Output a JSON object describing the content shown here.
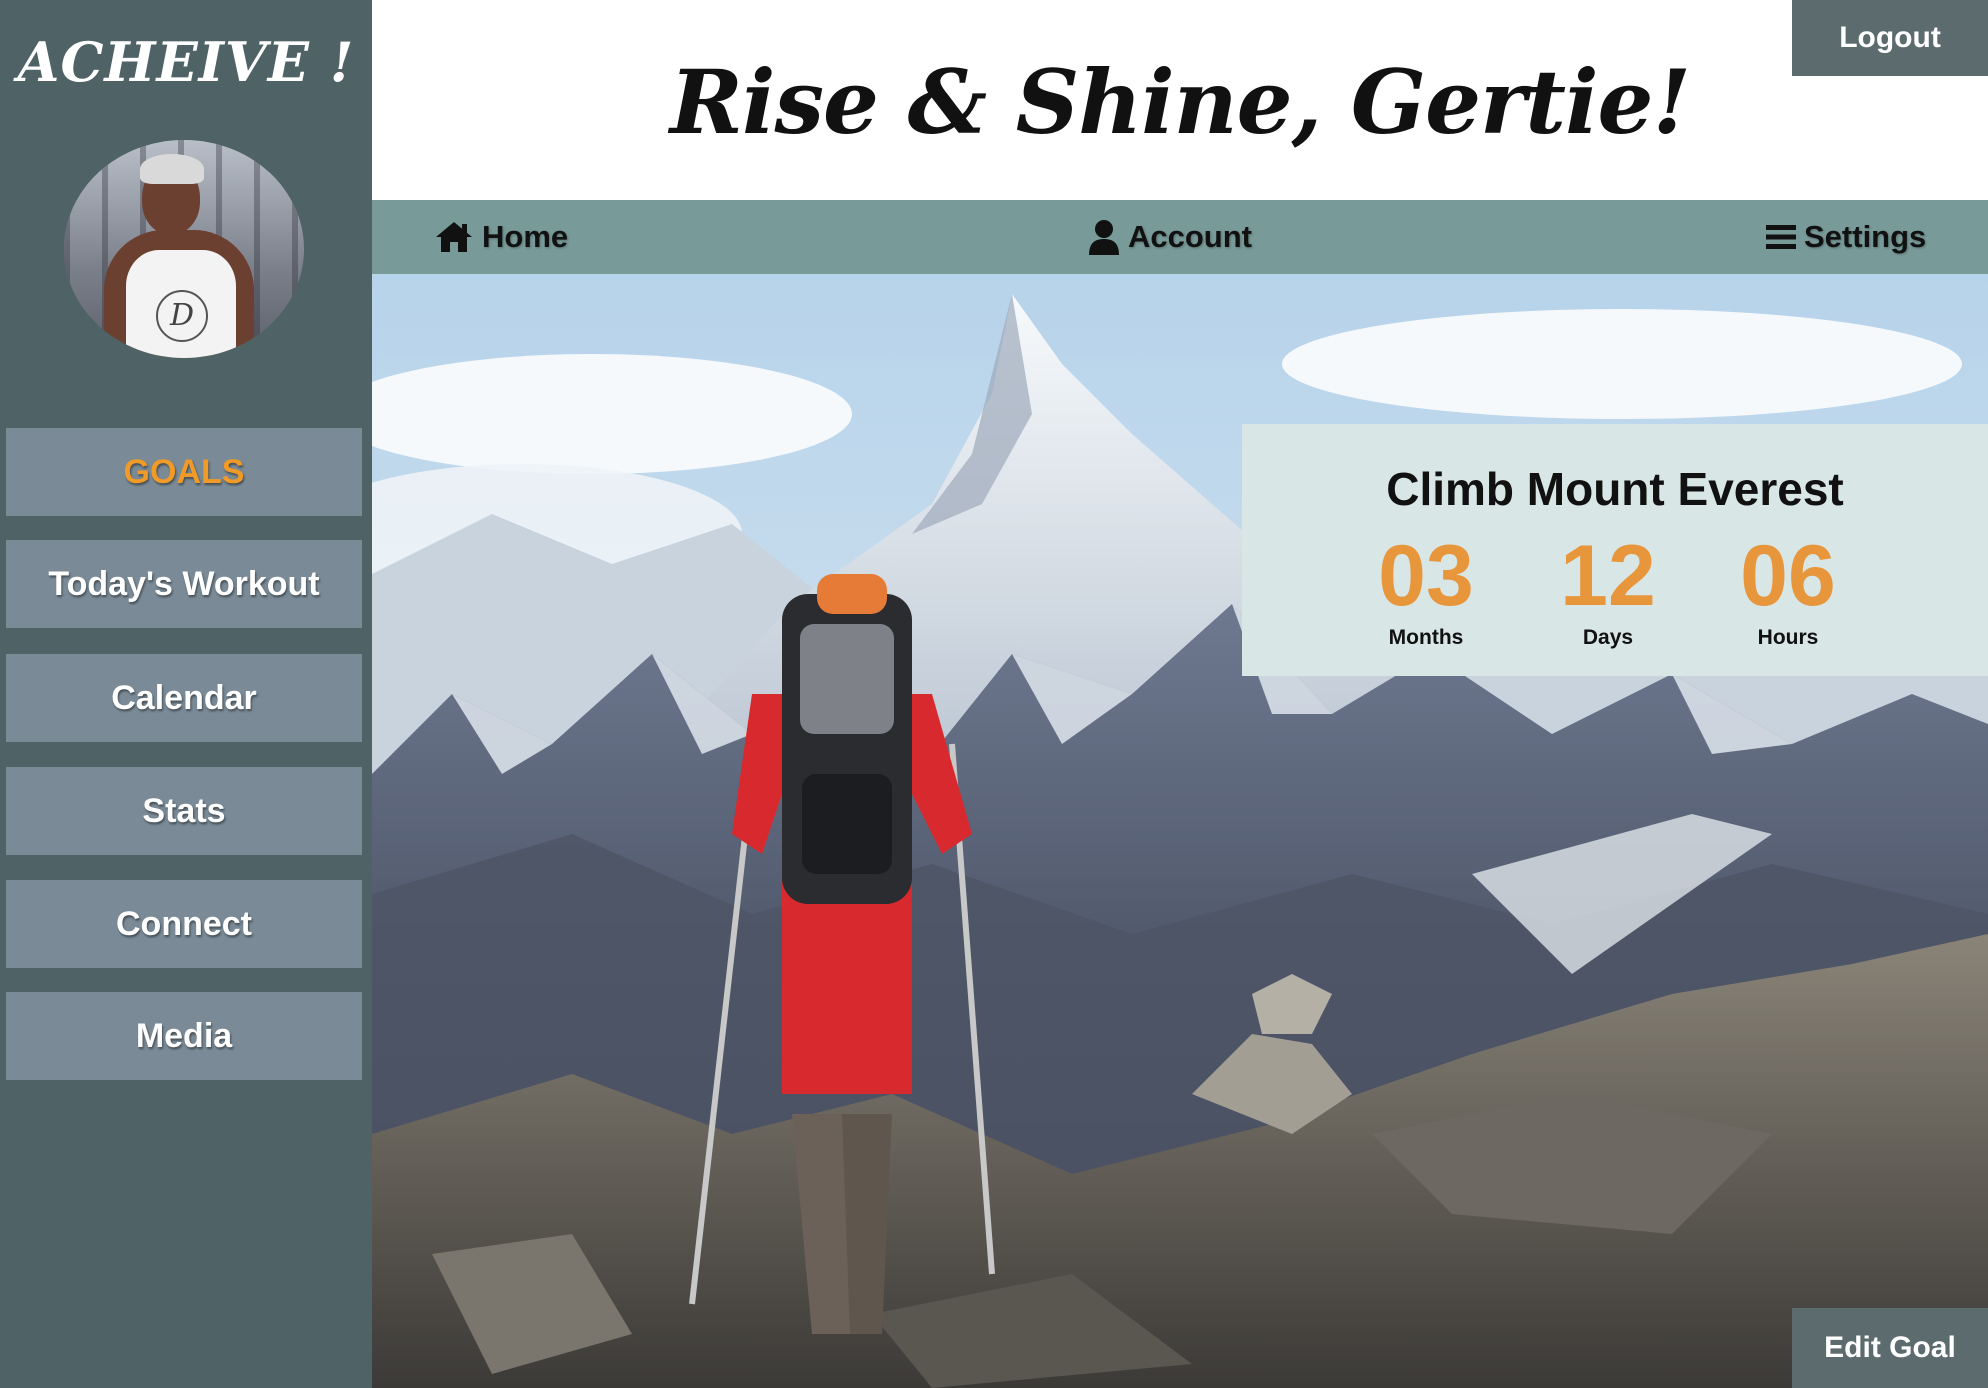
{
  "brand": {
    "name": "ACHEIVE !"
  },
  "header": {
    "greeting": "Rise & Shine, Gertie!",
    "logout_label": "Logout"
  },
  "sidebar": {
    "items": [
      {
        "label": "GOALS",
        "active": true
      },
      {
        "label": "Today's Workout"
      },
      {
        "label": "Calendar"
      },
      {
        "label": "Stats"
      },
      {
        "label": "Connect"
      },
      {
        "label": "Media"
      }
    ]
  },
  "topnav": {
    "home_label": "Home",
    "account_label": "Account",
    "settings_label": "Settings"
  },
  "goal": {
    "title": "Climb Mount Everest",
    "months": "03",
    "months_label": "Months",
    "days": "12",
    "days_label": "Days",
    "hours": "06",
    "hours_label": "Hours",
    "edit_label": "Edit Goal"
  },
  "icons": {
    "home": "home-icon",
    "account": "user-icon",
    "settings": "menu-icon"
  },
  "colors": {
    "sidebar_bg": "#4f6266",
    "nav_button_bg": "#7a8b97",
    "active_accent": "#f09a28",
    "topnav_bg": "#789a99",
    "goal_card_bg": "#d8e6e6",
    "counter_color": "#e8963c",
    "dark_button_bg": "#5c6b6d"
  }
}
